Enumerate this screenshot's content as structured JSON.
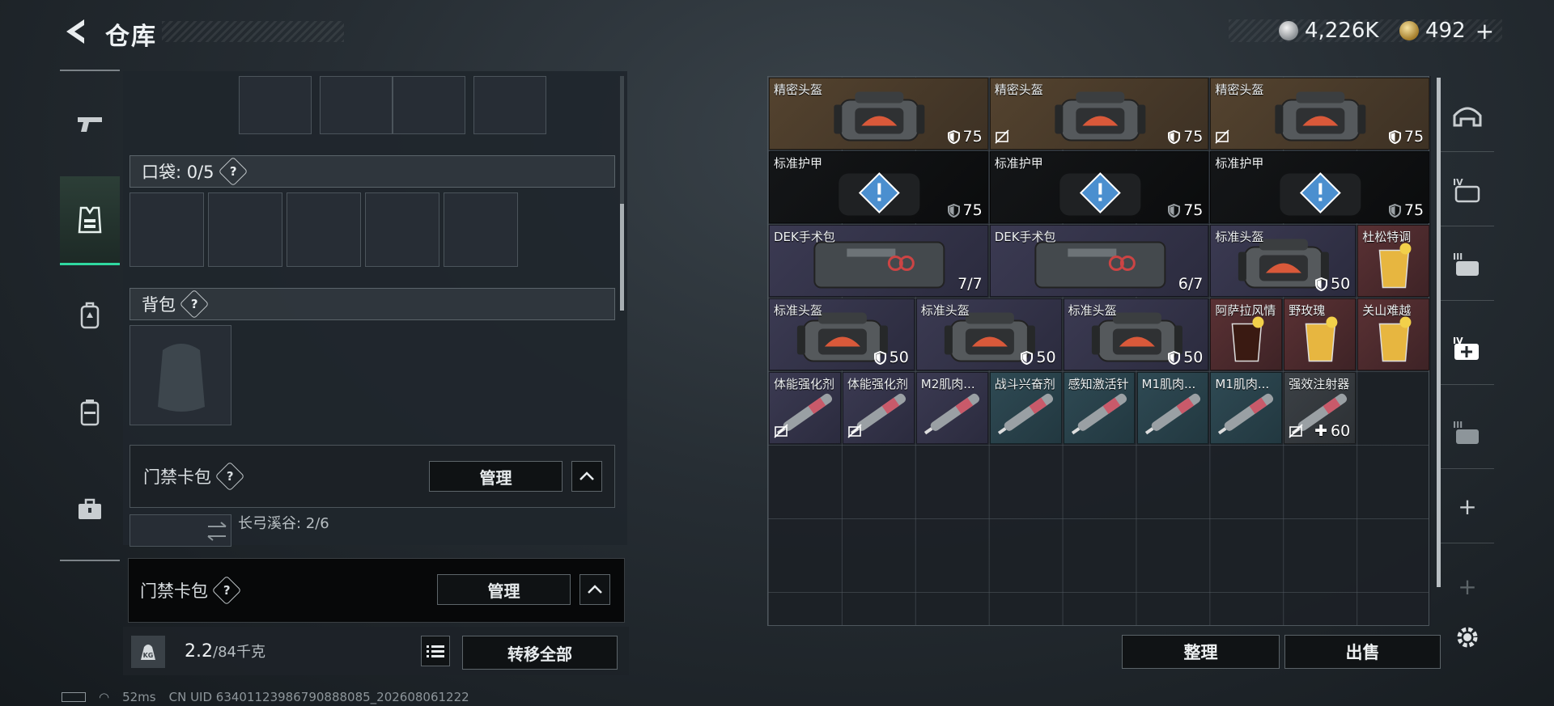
{
  "header": {
    "title": "仓库"
  },
  "currency": {
    "silver": "4,226K",
    "gold": "492"
  },
  "left_nav": [
    "gun-icon",
    "vest-icon",
    "backpack-icon",
    "pouch-icon",
    "case-icon"
  ],
  "middle": {
    "pocket_label": "口袋: 0/5",
    "backpack_label": "背包",
    "card_pack_label": "门禁卡包",
    "manage_label": "管理",
    "map_access": "长弓溪谷: 2/6",
    "popup_card_pack_label": "门禁卡包",
    "popup_manage_label": "管理",
    "weight": "2.2",
    "weight_max": "/84千克",
    "weight_icon_label": "KG",
    "transfer_all": "转移全部"
  },
  "inventory": {
    "items": [
      {
        "name": "精密头盔",
        "value": "75",
        "icon": "helmet-bag-icon"
      },
      {
        "name": "精密头盔",
        "value": "75",
        "icon": "helmet-bag-icon"
      },
      {
        "name": "精密头盔",
        "value": "75",
        "icon": "helmet-bag-icon"
      },
      {
        "name": "标准护甲",
        "value": "75",
        "icon": "armor-icon"
      },
      {
        "name": "标准护甲",
        "value": "75",
        "icon": "armor-icon"
      },
      {
        "name": "标准护甲",
        "value": "75",
        "icon": "armor-icon"
      },
      {
        "name": "DEK手术包",
        "value": "7/7",
        "icon": "surgery-kit-icon"
      },
      {
        "name": "DEK手术包",
        "value": "6/7",
        "icon": "surgery-kit-icon"
      },
      {
        "name": "标准头盔",
        "value": "50",
        "icon": "helmet-bag-icon"
      },
      {
        "name": "杜松特调",
        "value": "",
        "icon": "cocktail-icon"
      },
      {
        "name": "标准头盔",
        "value": "50",
        "icon": "helmet-bag-icon"
      },
      {
        "name": "标准头盔",
        "value": "50",
        "icon": "helmet-bag-icon"
      },
      {
        "name": "标准头盔",
        "value": "50",
        "icon": "helmet-bag-icon"
      },
      {
        "name": "阿萨拉风情",
        "value": "",
        "icon": "cola-icon"
      },
      {
        "name": "野玫瑰",
        "value": "",
        "icon": "cocktail-icon"
      },
      {
        "name": "关山难越",
        "value": "",
        "icon": "cocktail-icon"
      },
      {
        "name": "体能强化剂",
        "value": "",
        "icon": "injector-icon"
      },
      {
        "name": "体能强化剂",
        "value": "",
        "icon": "injector-icon"
      },
      {
        "name": "M2肌肉...",
        "value": "",
        "icon": "injector-icon"
      },
      {
        "name": "战斗兴奋剂",
        "value": "",
        "icon": "injector-icon"
      },
      {
        "name": "感知激活针",
        "value": "",
        "icon": "injector-icon"
      },
      {
        "name": "M1肌肉...",
        "value": "",
        "icon": "injector-icon"
      },
      {
        "name": "M1肌肉...",
        "value": "",
        "icon": "injector-icon"
      },
      {
        "name": "强效注射器",
        "value": "60",
        "icon": "injector-icon"
      }
    ],
    "arrange": "整理",
    "sell": "出售"
  },
  "right_nav": [
    "helmet-icon",
    "armor-iv-icon",
    "armor-iii-icon",
    "medkit-iv-icon",
    "armor-iii-b-icon",
    "plus-icon",
    "plus-icon-dim"
  ],
  "status": {
    "ping": "52ms",
    "uid": "CN UID 634011239867908880​85_202608061222"
  }
}
